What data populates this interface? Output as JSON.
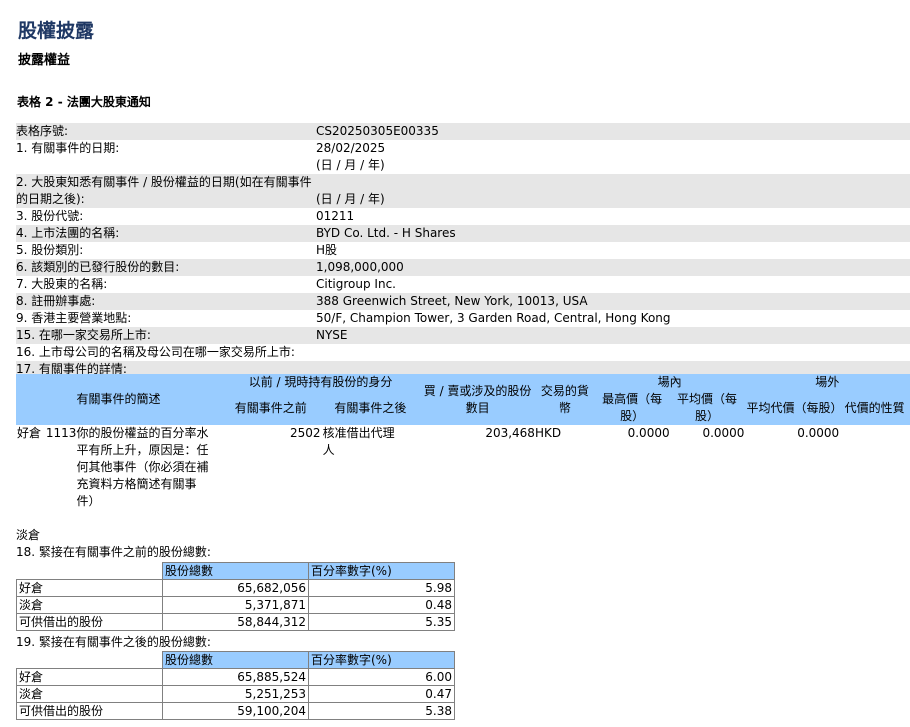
{
  "header": {
    "title": "股權披露",
    "subtitle": "披露權益",
    "form_name": "表格 2 - 法團大股東通知"
  },
  "details": [
    {
      "label": "表格序號:",
      "value": "CS20250305E00335",
      "shade": true
    },
    {
      "label": "1. 有關事件的日期:",
      "value": "28/02/2025",
      "note": "(日 / 月 / 年)",
      "shade": false
    },
    {
      "label": "2. 大股東知悉有關事件 / 股份權益的日期(如在有關事件",
      "label2": "的日期之後):",
      "value": "",
      "note": "(日 / 月 / 年)",
      "shade": true
    },
    {
      "label": "3. 股份代號:",
      "value": "01211",
      "shade": false
    },
    {
      "label": "4. 上市法團的名稱:",
      "value": "BYD Co. Ltd. - H Shares",
      "shade": true
    },
    {
      "label": "5. 股份類別:",
      "value": "H股",
      "shade": false
    },
    {
      "label": "6. 該類別的已發行股份的數目:",
      "value": "1,098,000,000",
      "shade": true
    },
    {
      "label": "7. 大股東的名稱:",
      "value": "Citigroup Inc.",
      "shade": false
    },
    {
      "label": "8. 註冊辦事處:",
      "value": "388 Greenwich Street, New York, 10013, USA",
      "shade": true
    },
    {
      "label": "9. 香港主要營業地點:",
      "value": "50/F, Champion Tower, 3 Garden Road, Central, Hong Kong",
      "shade": false
    },
    {
      "label": "15. 在哪一家交易所上市:",
      "value": "NYSE",
      "shade": true
    },
    {
      "label": "16. 上市母公司的名稱及母公司在哪一家交易所上市:",
      "value": "",
      "shade": false
    },
    {
      "label": "17. 有關事件的詳情:",
      "value": "",
      "shade": true
    }
  ],
  "event_table": {
    "headers": {
      "summary": "有關事件的簡述",
      "capacity": "以前 / 現時持有股份的身分",
      "before": "有關事件之前",
      "after": "有關事件之後",
      "shares": "買 / 賣或涉及的股份數目",
      "currency": "交易的貨幣",
      "onexch": "場內",
      "offexch": "場外",
      "high": "最高價（每股）",
      "avg": "平均價（每股）",
      "avg_off": "平均代價（每股）",
      "consideration": "代價的性質"
    },
    "row": {
      "position": "好倉",
      "code": "1113",
      "summary": "你的股份權益的百分率水平有所上升，原因是：任何其他事件（你必須在補充資料方格簡述有關事件）",
      "before_code": "2502",
      "after": "核准借出代理人",
      "shares": "203,468",
      "currency": "HKD",
      "high": "0.0000",
      "avg": "0.0000",
      "avg_off": "0.0000"
    },
    "short_label": "淡倉"
  },
  "section18": {
    "title": "18. 緊接在有關事件之前的股份總數:",
    "col1": "股份總數",
    "col2": "百分率數字(%)",
    "rows": [
      {
        "label": "好倉",
        "shares": "65,682,056",
        "pct": "5.98"
      },
      {
        "label": "淡倉",
        "shares": "5,371,871",
        "pct": "0.48"
      },
      {
        "label": "可供借出的股份",
        "shares": "58,844,312",
        "pct": "5.35"
      }
    ]
  },
  "section19": {
    "title": "19. 緊接在有關事件之後的股份總數:",
    "col1": "股份總數",
    "col2": "百分率數字(%)",
    "rows": [
      {
        "label": "好倉",
        "shares": "65,885,524",
        "pct": "6.00"
      },
      {
        "label": "淡倉",
        "shares": "5,251,253",
        "pct": "0.47"
      },
      {
        "label": "可供借出的股份",
        "shares": "59,100,204",
        "pct": "5.38"
      }
    ]
  },
  "colors": {
    "title": "#1f3864",
    "header_bg": "#99ccff",
    "shade": "#e6e6e6"
  }
}
